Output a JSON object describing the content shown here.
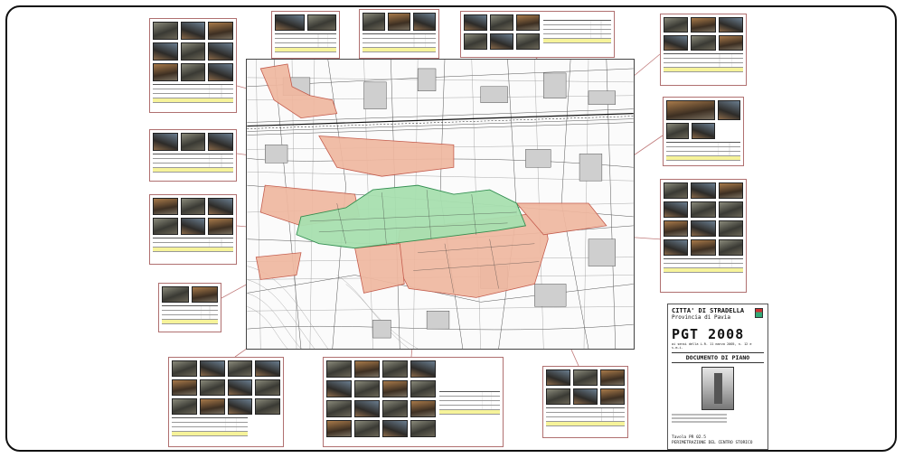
{
  "title_block": {
    "city": "CITTA' DI STRADELLA",
    "province": "Provincia di Pavia",
    "plan": "PGT 2008",
    "subtitle": "ai sensi della L.R. 11 marzo 2005, n. 12 e s.m.i.",
    "document": "DOCUMENTO DI PIANO",
    "table_code": "Tavola PR 02.5",
    "table_title": "PERIMETRAZIONE DEL CENTRO STORICO"
  },
  "colors": {
    "historic_center": "#a8e0b0",
    "expansion_zone": "#f0b8a0",
    "board_border": "#b07070",
    "highlight_row": "#f6f39a"
  },
  "boards": [
    {
      "id": "nw-top",
      "photos": 12
    },
    {
      "id": "n-1",
      "photos": 2
    },
    {
      "id": "n-2",
      "photos": 3
    },
    {
      "id": "n-3",
      "photos": 6
    },
    {
      "id": "ne-top",
      "photos": 9
    },
    {
      "id": "w-1",
      "photos": 3
    },
    {
      "id": "w-2",
      "photos": 6
    },
    {
      "id": "w-3",
      "photos": 2
    },
    {
      "id": "e-1",
      "photos": 4
    },
    {
      "id": "e-2",
      "photos": 15
    },
    {
      "id": "sw",
      "photos": 15
    },
    {
      "id": "s",
      "photos": 20
    },
    {
      "id": "se",
      "photos": 9
    }
  ]
}
